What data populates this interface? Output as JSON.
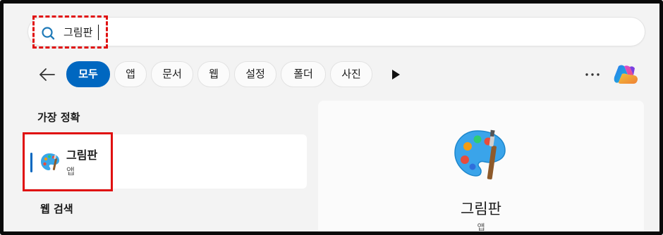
{
  "search": {
    "query": "그림판"
  },
  "filters": {
    "chips": [
      "모두",
      "앱",
      "문서",
      "웹",
      "설정",
      "폴더",
      "사진"
    ],
    "active_index": 0
  },
  "best_match": {
    "heading": "가장 정확",
    "item": {
      "name": "그림판",
      "type": "앱",
      "icon": "paint-palette-icon"
    }
  },
  "web_search": {
    "heading": "웹 검색"
  },
  "preview": {
    "name": "그림판",
    "type": "앱",
    "icon": "paint-palette-icon"
  },
  "colors": {
    "accent": "#0067c0",
    "highlight": "#e01010",
    "background": "#f3f3f3"
  }
}
